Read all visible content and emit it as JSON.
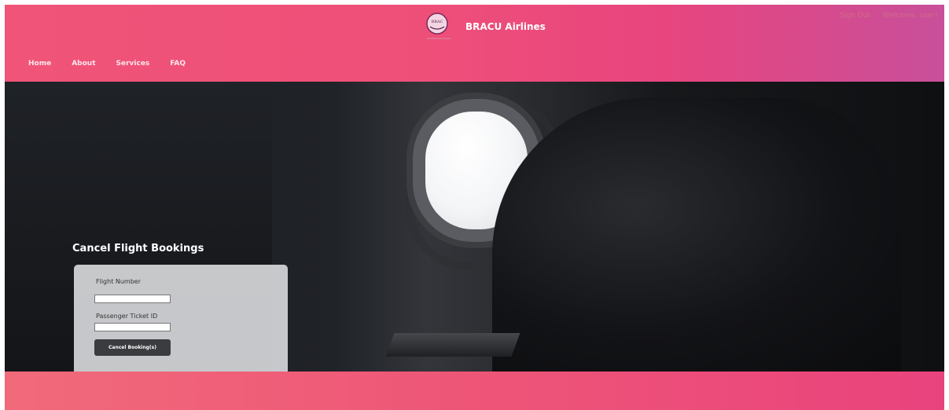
{
  "header": {
    "brand_name": "BRACU Airlines",
    "logo_text": "BRAC",
    "sign_out": "Sign Out",
    "welcome": "Welcome, user!"
  },
  "nav": {
    "items": [
      {
        "label": "Home"
      },
      {
        "label": "About"
      },
      {
        "label": "Services"
      },
      {
        "label": "FAQ"
      }
    ]
  },
  "main": {
    "title": "Cancel Flight Bookings",
    "form": {
      "flight_number_label": "Flight Number",
      "flight_number_value": "",
      "ticket_id_label": "Passenger Ticket ID",
      "ticket_id_value": "",
      "submit_label": "Cancel Booking(s)"
    }
  },
  "colors": {
    "header_pink": "#ee4f79",
    "header_purple": "#c84f9a",
    "button_dark": "#3b3c3f",
    "card_gray": "#d6d7d9"
  }
}
